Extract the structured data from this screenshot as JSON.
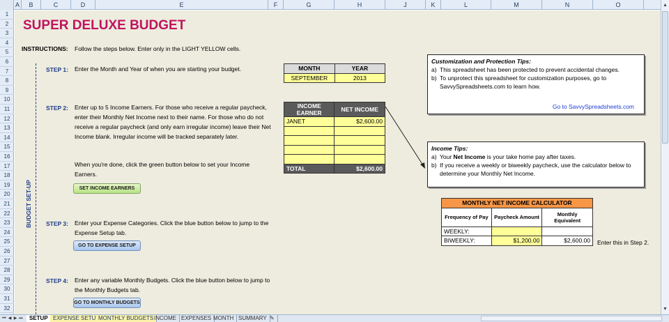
{
  "columns": [
    "A",
    "B",
    "C",
    "D",
    "E",
    "F",
    "G",
    "H",
    "J",
    "K",
    "L",
    "M",
    "N",
    "O"
  ],
  "rows": [
    "1",
    "2",
    "3",
    "4",
    "5",
    "6",
    "7",
    "8",
    "9",
    "10",
    "11",
    "12",
    "13",
    "14",
    "15",
    "16",
    "17",
    "18",
    "19",
    "20",
    "21",
    "22",
    "23",
    "24",
    "25",
    "26",
    "27",
    "28",
    "29",
    "30",
    "31",
    "32"
  ],
  "title": "SUPER DELUXE BUDGET",
  "instructions": {
    "label": "INSTRUCTIONS:",
    "text": "Follow the steps below.  Enter only in the LIGHT YELLOW cells."
  },
  "section_label": "BUDGET SET-UP",
  "steps": [
    {
      "label": "STEP 1:",
      "text": "Enter the Month and Year of when you are starting your budget."
    },
    {
      "label": "STEP 2:",
      "text": "Enter up to 5 Income Earners.  For those who receive a regular paycheck, enter their Monthly Net Income next to their name.  For those who do not receive a regular paycheck (and only earn irregular income) leave their Net Income blank.  Irregular income will be tracked separately later.",
      "text2": "When you're done, click the green button below to set your Income Earners."
    },
    {
      "label": "STEP 3:",
      "text": "Enter your Expense Categories.  Click the blue button below to jump to the Expense Setup tab."
    },
    {
      "label": "STEP 4:",
      "text": "Enter any variable Monthly Budgets.  Click the blue button below to jump to the Monthly Budgets tab."
    }
  ],
  "buttons": {
    "set_income": "SET INCOME EARNERS",
    "expense_setup": "GO TO EXPENSE SETUP",
    "monthly_budgets": "GO TO MONTHLY BUDGETS"
  },
  "month_table": {
    "month_header": "MONTH",
    "year_header": "YEAR",
    "month": "SEPTEMBER",
    "year": "2013"
  },
  "income_table": {
    "earner_header": "INCOME EARNER",
    "income_header": "NET INCOME",
    "rows": [
      {
        "earner": "JANET",
        "income": "$2,600.00"
      },
      {
        "earner": "",
        "income": ""
      },
      {
        "earner": "",
        "income": ""
      },
      {
        "earner": "",
        "income": ""
      },
      {
        "earner": "",
        "income": ""
      }
    ],
    "total_label": "TOTAL",
    "total_value": "$2,600.00"
  },
  "customization_box": {
    "title": "Customization  and  Protection Tips:",
    "a": "This spreadsheet has been protected to prevent  accidental changes.",
    "b": "To unprotect  this spreadsheet for customization  purposes, go to SavvySpreadsheets.com  to learn how.",
    "link": "Go to SavvySpreadsheets.com"
  },
  "income_tips_box": {
    "title": "Income Tips:",
    "a_pre": "Your ",
    "a_bold": "Net Income",
    "a_post": " is your take home pay after taxes.",
    "b": "If you receive a weekly or biweekly paycheck, use the calculator below to determine your Monthly Net Income."
  },
  "calculator": {
    "title": "MONTHLY NET INCOME CALCULATOR",
    "col1": "Frequency of Pay",
    "col2": "Paycheck Amount",
    "col3": "Monthly Equivalent",
    "weekly_label": "WEEKLY:",
    "weekly_amount": "",
    "weekly_equiv": "",
    "biweekly_label": "BIWEEKLY:",
    "biweekly_amount": "$1,200.00",
    "biweekly_equiv": "$2,600.00",
    "note": "Enter this in Step 2."
  },
  "tabs": [
    "SETUP",
    "EXPENSE SETUP",
    "MONTHLY BUDGETS",
    "INCOME",
    "EXPENSES",
    "MONTH",
    "SUMMARY"
  ]
}
